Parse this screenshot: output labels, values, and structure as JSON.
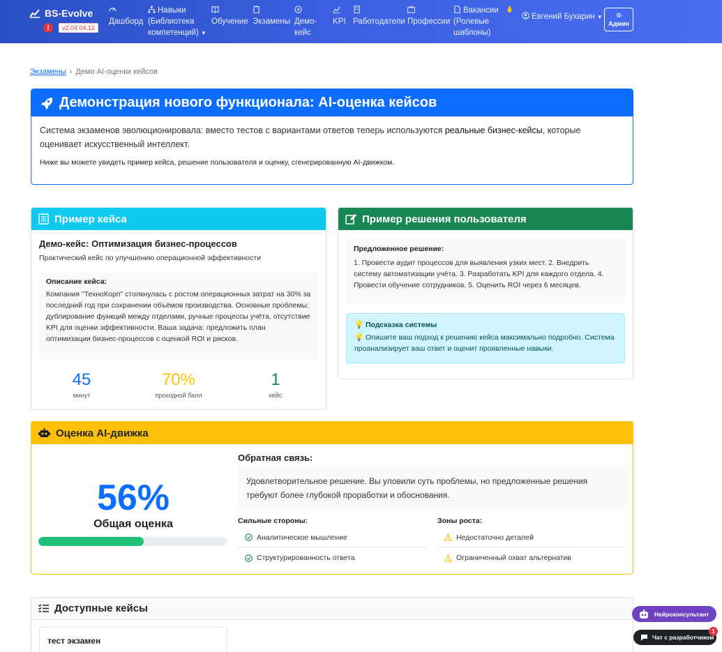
{
  "navbar": {
    "brand": "BS-Evolve",
    "version": "v2.04 04.12",
    "alert": "!",
    "items": [
      {
        "label": "Дашборд"
      },
      {
        "label": "Навыки (Библиотека компетенций)"
      },
      {
        "label": "Обучение"
      },
      {
        "label": "Экзамены"
      },
      {
        "label": "Демо-кейс"
      },
      {
        "label": "KPI"
      },
      {
        "label": "Работодатели"
      },
      {
        "label": "Профессии"
      },
      {
        "label": "Вакансии (Ролевые шаблоны)"
      }
    ],
    "user": "Евгений Бухарин",
    "admin": "Админ"
  },
  "breadcrumb": {
    "parent": "Экзамены",
    "current": "Демо AI-оценки кейсов"
  },
  "demo": {
    "title": "Демонстрация нового функционала: AI-оценка кейсов",
    "lead_1": "Система экзаменов эволюционировала: вместо тестов с вариантами ответов теперь используются ",
    "lead_strong": "реальные бизнес-кейсы",
    "lead_2": ", которые оценивает искусственный интеллект.",
    "note": "Ниже вы можете увидеть пример кейса, решение пользователя и оценку, сгенерированную AI-движком."
  },
  "case": {
    "header": "Пример кейса",
    "title": "Демо-кейс: Оптимизация бизнес-процессов",
    "subtitle": "Практический кейс по улучшению операционной эффективности",
    "desc_label": "Описание кейса:",
    "desc_text": "Компания \"ТехноКорп\" столкнулась с ростом операционных затрат на 30% за последний год при сохранении объёмов производства. Основные проблемы: дублирование функций между отделами, ручные процессы учёта, отсутствие KPI для оценки эффективности. Ваша задача: предложить план оптимизации бизнес-процессов с оценкой ROI и рисков.",
    "stats": [
      {
        "value": "45",
        "caption": "минут",
        "color": "#0d6efd"
      },
      {
        "value": "70%",
        "caption": "проходной балл",
        "color": "#ffc107"
      },
      {
        "value": "1",
        "caption": "кейс",
        "color": "#198754"
      }
    ]
  },
  "solution": {
    "header": "Пример решения пользователя",
    "label": "Предложенное решение:",
    "text": "1. Провести аудит процессов для выявления узких мест. 2. Внедрить систему автоматизации учёта. 3. Разработать KPI для каждого отдела. 4. Провести обучение сотрудников. 5. Оценить ROI через 6 месяцев.",
    "hint_label": "Подсказка системы",
    "hint_text": "💡 Опишите ваш подход к решению кейса максимально подробно. Система проанализирует ваш ответ и оценит проявленные навыки."
  },
  "ai": {
    "header": "Оценка AI-движка",
    "score": "56%",
    "score_value": 0.56,
    "score_caption": "Общая оценка",
    "feedback_label": "Обратная связь:",
    "feedback": "Удовлетворительное решение. Вы уловили суть проблемы, но предложенные решения требуют более глубокой проработки и обоснования.",
    "strengths_label": "Сильные стороны:",
    "strengths": [
      "Аналитическое мышление",
      "Структурированность ответа"
    ],
    "growth_label": "Зоны роста:",
    "growth": [
      "Недостаточно деталей",
      "Ограниченный охват альтернатив"
    ]
  },
  "available": {
    "header": "Доступные кейсы",
    "items": [
      {
        "title": "тест экзамен"
      }
    ]
  },
  "floating": {
    "neuro": "Нейроконсультант",
    "chat": "Чат с разработчиком",
    "chat_badge": "1"
  }
}
